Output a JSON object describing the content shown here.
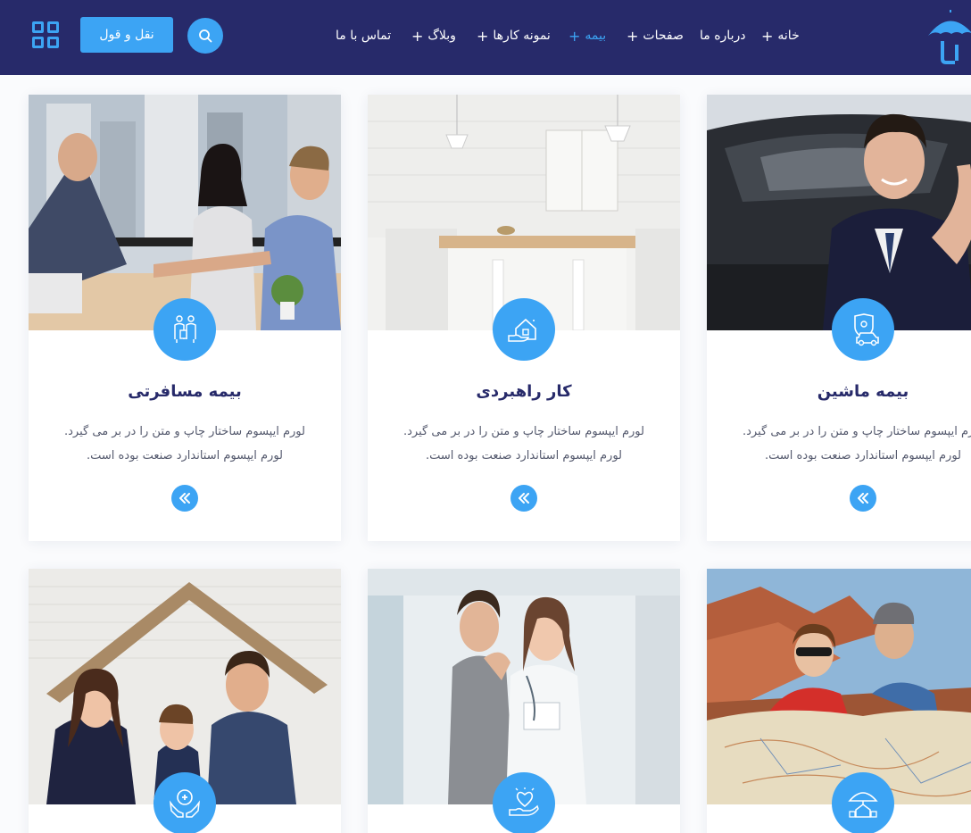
{
  "header": {
    "nav": [
      {
        "label": "خانه",
        "plus": "+",
        "active": false
      },
      {
        "label": "درباره ما",
        "plus": "",
        "active": false
      },
      {
        "label": "صفحات",
        "plus": "+",
        "active": false
      },
      {
        "label": "بیمه",
        "plus": "+",
        "active": true
      },
      {
        "label": "نمونه کارها",
        "plus": "+",
        "active": false
      },
      {
        "label": "وبلاگ",
        "plus": "+",
        "active": false
      },
      {
        "label": "تماس با ما",
        "plus": "",
        "active": false
      }
    ],
    "quote_button": "نقل و قول",
    "search_icon": "search-icon",
    "menu_icon": "grid-menu-icon",
    "logo_icon": "umbrella-logo-icon"
  },
  "cards": [
    {
      "title": "بیمه ماشین",
      "text_line1": "لورم ایپسوم ساختار چاپ و متن را در بر می گیرد.",
      "text_line2": "لورم ایپسوم استاندارد صنعت بوده است.",
      "icon": "car-shield-icon",
      "image": "businessman-car-photo",
      "link_icon": "double-chevron-left-icon"
    },
    {
      "title": "کار راهبردی",
      "text_line1": "لورم ایپسوم ساختار چاپ و متن را در بر می گیرد.",
      "text_line2": "لورم ایپسوم استاندارد صنعت بوده است.",
      "icon": "house-hand-icon",
      "image": "kitchen-photo",
      "link_icon": "double-chevron-left-icon"
    },
    {
      "title": "بیمه مسافرتی",
      "text_line1": "لورم ایپسوم ساختار چاپ و متن را در بر می گیرد.",
      "text_line2": "لورم ایپسوم استاندارد صنعت بوده است.",
      "icon": "travelers-icon",
      "image": "handshake-meeting-photo",
      "link_icon": "double-chevron-left-icon"
    },
    {
      "title": "",
      "icon": "umbrella-house-icon",
      "image": "travelers-map-photo"
    },
    {
      "title": "",
      "icon": "heart-hand-icon",
      "image": "doctor-patient-photo"
    },
    {
      "title": "",
      "icon": "medical-hands-icon",
      "image": "family-roof-photo"
    }
  ],
  "colors": {
    "header_bg": "#272a6a",
    "accent": "#3ca4f4",
    "title": "#272a6a",
    "text": "#555a6e"
  }
}
